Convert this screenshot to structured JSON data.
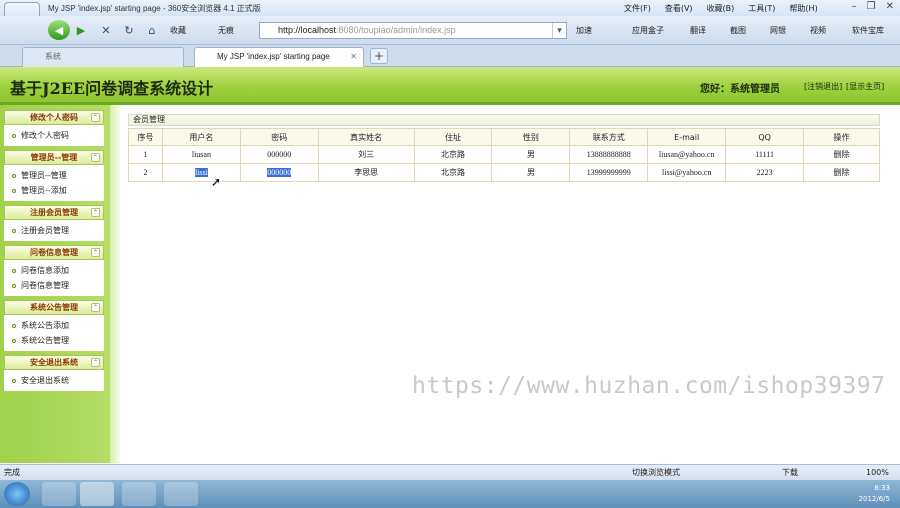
{
  "browser": {
    "window_title": "My JSP 'index.jsp' starting page - 360安全浏览器 4.1 正式版",
    "menus": [
      "文件(F)",
      "查看(V)",
      "收藏(B)",
      "工具(T)",
      "帮助(H)"
    ],
    "nav": {
      "favorites_label": "收藏",
      "clean_label": "无痕",
      "address_host": "http://localhost",
      "address_rest": ":8080/toupiao/admin/index.jsp",
      "accelerate_label": "加速",
      "right_links": [
        "应用盒子",
        "翻译",
        "截图",
        "网银",
        "视频",
        "软件宝库"
      ]
    },
    "tabs": [
      {
        "label": "系统"
      },
      {
        "label": "My JSP 'index.jsp' starting page"
      }
    ],
    "status_text": "完成",
    "status_right": {
      "mode_label": "切换浏览模式",
      "download_label": "下载",
      "zoom": "100%"
    }
  },
  "app": {
    "system_title": "基于J2EE问卷调查系统设计",
    "greeting": "您好：系统管理员",
    "logout_label": "[注销退出]",
    "home_label": "[显示主页]"
  },
  "sidebar": [
    {
      "title": "修改个人密码",
      "items": [
        "修改个人密码"
      ]
    },
    {
      "title": "管理员--管理",
      "items": [
        "管理员--管理",
        "管理员--添加"
      ]
    },
    {
      "title": "注册会员管理",
      "items": [
        "注册会员管理"
      ]
    },
    {
      "title": "问卷信息管理",
      "items": [
        "问卷信息添加",
        "问卷信息管理"
      ]
    },
    {
      "title": "系统公告管理",
      "items": [
        "系统公告添加",
        "系统公告管理"
      ]
    },
    {
      "title": "安全退出系统",
      "items": [
        "安全退出系统"
      ]
    }
  ],
  "main": {
    "breadcrumb": "会员管理",
    "columns": [
      "序号",
      "用户名",
      "密码",
      "真实姓名",
      "住址",
      "性别",
      "联系方式",
      "E-mail",
      "QQ",
      "操作"
    ],
    "rows": [
      [
        "1",
        "liusan",
        "000000",
        "刘三",
        "北京路",
        "男",
        "13888888888",
        "liusan@yahoo.cn",
        "11111",
        "删除"
      ],
      [
        "2",
        "lissi",
        "000000",
        "李思思",
        "北京路",
        "男",
        "13999999999",
        "lissi@yahoo.cn",
        "2223",
        "删除"
      ]
    ],
    "watermark": "https://www.huzhan.com/ishop39397"
  },
  "taskbar": {
    "time": "8:33",
    "date": "2012/6/5"
  },
  "colors": {
    "header_green": "#9ccf3b",
    "sidebar_green": "#9fd24a",
    "selection_blue": "#3a6fd8"
  }
}
